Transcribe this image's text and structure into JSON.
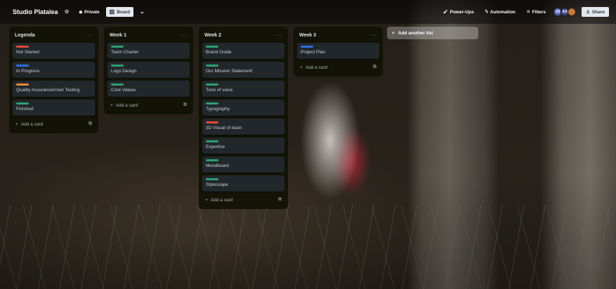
{
  "header": {
    "board_title": "Studio Platalea",
    "visibility_label": "Private",
    "view_label": "Board",
    "powerups_label": "Power-Ups",
    "automation_label": "Automation",
    "filters_label": "Filters",
    "avatars": [
      {
        "initials": "JA",
        "color": "#5e6ec6"
      },
      {
        "initials": "AA",
        "color": "#3c4a8a"
      }
    ],
    "share_label": "Share"
  },
  "labels": {
    "red": "#e2483d",
    "blue": "#2f6fe0",
    "orange": "#e8873a",
    "green": "#2f9e72"
  },
  "lists": [
    {
      "title": "Legenda",
      "cards": [
        {
          "text": "Not Started",
          "label": "red"
        },
        {
          "text": "In Progress",
          "label": "blue"
        },
        {
          "text": "Quality Assurance/User Testing",
          "label": "orange"
        },
        {
          "text": "Finished",
          "label": "green"
        }
      ],
      "add_label": "Add a card"
    },
    {
      "title": "Week 1",
      "cards": [
        {
          "text": "Team Charter",
          "label": "green"
        },
        {
          "text": "Logo Design",
          "label": "green"
        },
        {
          "text": "Core Values",
          "label": "green"
        }
      ],
      "add_label": "Add a card"
    },
    {
      "title": "Week 2",
      "cards": [
        {
          "text": "Brand Guide",
          "label": "green"
        },
        {
          "text": "Our Mission Statement",
          "label": "green"
        },
        {
          "text": "Tone of voice",
          "label": "green"
        },
        {
          "text": "Typography",
          "label": "green"
        },
        {
          "text": "3D Visual of team",
          "label": "red"
        },
        {
          "text": "Expertise",
          "label": "green"
        },
        {
          "text": "Moodboard",
          "label": "green"
        },
        {
          "text": "Stylescape",
          "label": "green"
        }
      ],
      "add_label": "Add a card"
    },
    {
      "title": "Week 3",
      "cards": [
        {
          "text": "Project Plan",
          "label": "blue"
        }
      ],
      "add_label": "Add a card"
    }
  ],
  "add_list_label": "Add another list"
}
